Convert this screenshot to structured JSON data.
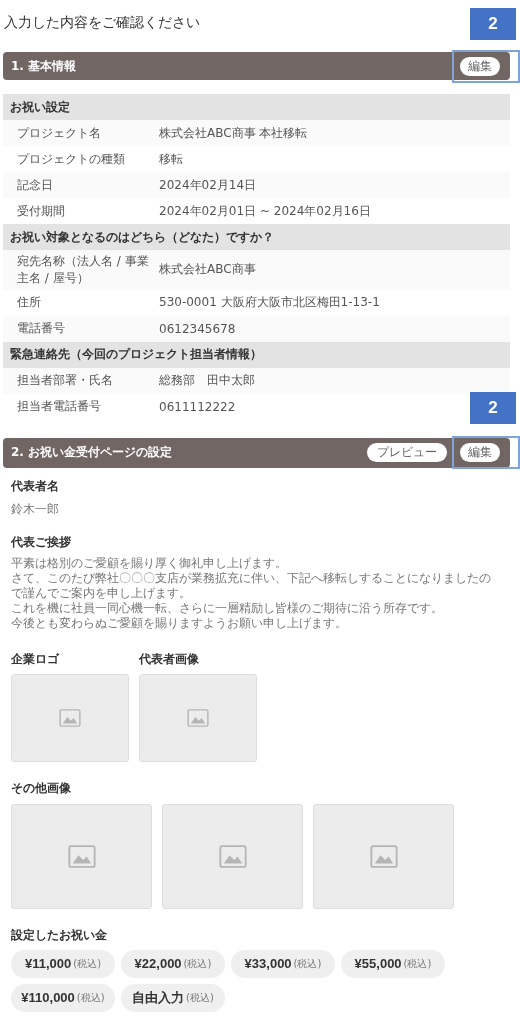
{
  "page_title": "入力した内容をご確認ください",
  "section1": {
    "title": "1. 基本情報",
    "edit_button": "編集",
    "annotation": "2",
    "groups": [
      {
        "heading": "お祝い設定",
        "rows": [
          {
            "label": "プロジェクト名",
            "value": "株式会社ABC商事 本社移転"
          },
          {
            "label": "プロジェクトの種類",
            "value": "移転"
          },
          {
            "label": "記念日",
            "value": "2024年02月14日"
          },
          {
            "label": "受付期間",
            "value": "2024年02月01日 ~ 2024年02月16日"
          }
        ]
      },
      {
        "heading": "お祝い対象となるのはどちら（どなた）ですか？",
        "rows": [
          {
            "label": "宛先名称（法人名 / 事業主名 / 屋号）",
            "value": "株式会社ABC商事"
          },
          {
            "label": "住所",
            "value": "530-0001 大阪府大阪市北区梅田1-13-1"
          },
          {
            "label": "電話番号",
            "value": "0612345678"
          }
        ]
      },
      {
        "heading": "緊急連絡先（今回のプロジェクト担当者情報）",
        "rows": [
          {
            "label": "担当者部署・氏名",
            "value": "総務部　田中太郎"
          },
          {
            "label": "担当者電話番号",
            "value": "0611112222"
          }
        ]
      }
    ]
  },
  "section2": {
    "title": "2. お祝い金受付ページの設定",
    "preview_button": "プレビュー",
    "edit_button": "編集",
    "annotation": "2",
    "representative_label": "代表者名",
    "representative_name": "鈴木一郎",
    "greeting_label": "代表ご挨拶",
    "greeting": [
      "平素は格別のご愛顧を賜り厚く御礼申し上げます。",
      "さて、このたび弊社〇〇〇支店が業務拡充に伴い、下記へ移転しすることになりましたので謹んでご案内を申し上げます。",
      "これを機に社員一同心機一転、さらに一層精励し皆様のご期待に沿う所存です。",
      "今後とも変わらぬご愛顧を賜りますようお願い申し上げます。"
    ],
    "image_fields": [
      {
        "label": "企業ロゴ"
      },
      {
        "label": "代表者画像"
      }
    ],
    "other_images_label": "その他画像",
    "amounts_label": "設定したお祝い金",
    "amounts": [
      {
        "amount": "¥11,000",
        "tax": "(税込)"
      },
      {
        "amount": "¥22,000",
        "tax": "(税込)"
      },
      {
        "amount": "¥33,000",
        "tax": "(税込)"
      },
      {
        "amount": "¥55,000",
        "tax": "(税込)"
      },
      {
        "amount": "¥110,000",
        "tax": "(税込)"
      },
      {
        "amount": "自由入力",
        "tax": "(税込)"
      }
    ]
  }
}
